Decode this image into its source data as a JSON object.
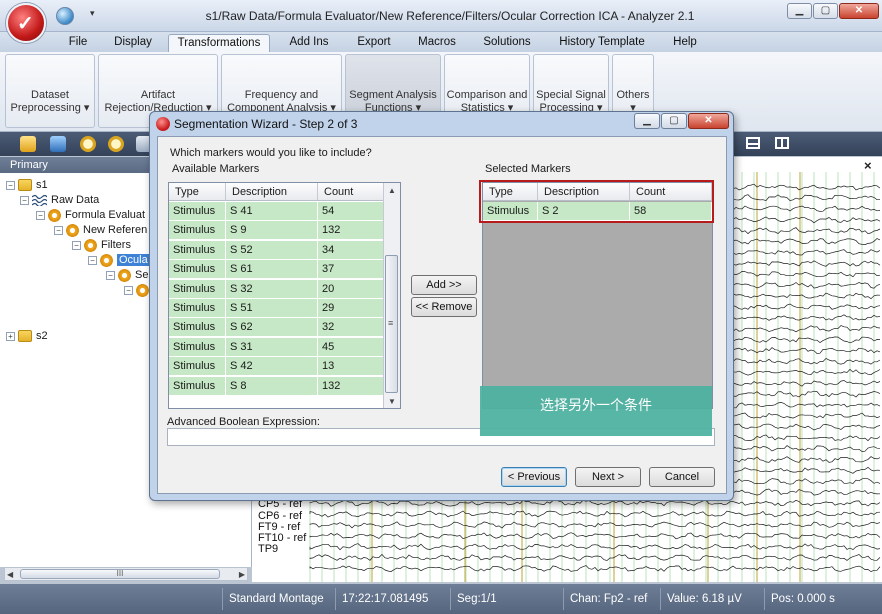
{
  "window": {
    "title": "s1/Raw Data/Formula Evaluator/New Reference/Filters/Ocular Correction ICA - Analyzer 2.1",
    "min_glyph": "▁",
    "max_glyph": "▢",
    "close_glyph": "✕"
  },
  "menu": {
    "tabs": [
      "File",
      "Display",
      "Transformations",
      "Add Ins",
      "Export",
      "Macros",
      "Solutions",
      "History Template",
      "Help"
    ],
    "active": "Transformations"
  },
  "ribbon": {
    "groups": [
      {
        "line1": "Dataset",
        "line2": "Preprocessing ▾"
      },
      {
        "line1": "Artifact",
        "line2": "Rejection/Reduction ▾"
      },
      {
        "line1": "Frequency and",
        "line2": "Component Analysis ▾"
      },
      {
        "line1": "Segment Analysis",
        "line2": "Functions ▾"
      },
      {
        "line1": "Comparison and",
        "line2": "Statistics ▾"
      },
      {
        "line1": "Special Signal",
        "line2": "Processing ▾"
      },
      {
        "line1": "Others",
        "line2": "▾"
      }
    ]
  },
  "left_panel": {
    "header": "Primary",
    "tree": [
      "s1",
      "Raw Data",
      "Formula Evaluat",
      "New Referen",
      "Filters",
      "Ocula",
      "Se",
      "s2"
    ],
    "scroll_label": "III",
    "scroll_left": "◀",
    "scroll_right": "▶"
  },
  "eeg": {
    "close": "×",
    "visible_channels": [
      "CP5 - ref",
      "CP6 - ref",
      "FT9 - ref",
      "FT10 - ref",
      "TP9"
    ]
  },
  "status_bar": {
    "montage": "Standard Montage",
    "time": "17:22:17.081495",
    "segment": "Seg:1/1",
    "channel": "Chan:  Fp2 - ref",
    "value": "Value: 6.18 µV",
    "position": "Pos:  0.000 s"
  },
  "dialog": {
    "title": "Segmentation Wizard - Step 2 of 3",
    "question": "Which markers would you like to include?",
    "available_label": "Available Markers",
    "selected_label": "Selected Markers",
    "columns": [
      "Type",
      "Description",
      "Count"
    ],
    "available_markers": [
      {
        "type": "Stimulus",
        "description": "S 41",
        "count": "54"
      },
      {
        "type": "Stimulus",
        "description": "S  9",
        "count": "132"
      },
      {
        "type": "Stimulus",
        "description": "S 52",
        "count": "34"
      },
      {
        "type": "Stimulus",
        "description": "S 61",
        "count": "37"
      },
      {
        "type": "Stimulus",
        "description": "S 32",
        "count": "20"
      },
      {
        "type": "Stimulus",
        "description": "S 51",
        "count": "29"
      },
      {
        "type": "Stimulus",
        "description": "S 62",
        "count": "32"
      },
      {
        "type": "Stimulus",
        "description": "S 31",
        "count": "45"
      },
      {
        "type": "Stimulus",
        "description": "S 42",
        "count": "13"
      },
      {
        "type": "Stimulus",
        "description": "S  8",
        "count": "132"
      }
    ],
    "selected_markers": [
      {
        "type": "Stimulus",
        "description": "S  2",
        "count": "58"
      }
    ],
    "add_button": "Add >>",
    "remove_button": "<< Remove",
    "boolean_label": "Advanced Boolean Expression:",
    "boolean_value": "",
    "previous_button": "< Previous",
    "next_button": "Next >",
    "cancel_button": "Cancel",
    "scroll_up": "▲",
    "scroll_down": "▼",
    "scroll_grip": "≡"
  },
  "annotation": {
    "text": "选择另外一个条件"
  },
  "colors": {
    "marker_row": "#c6e8c6",
    "selection_outline": "#b81b1b",
    "annotation_bg": "#4cb2a0",
    "eeg_marker_line": "#c8b458",
    "eeg_grid_line": "#8fd08f"
  }
}
